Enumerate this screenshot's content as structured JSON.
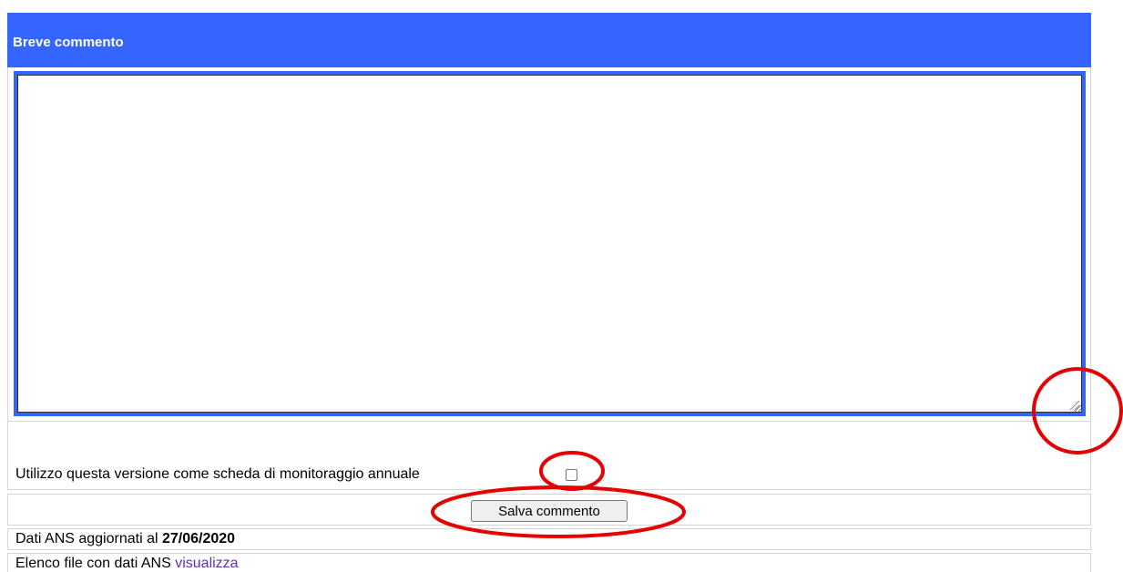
{
  "panel": {
    "title": "Breve commento"
  },
  "comment": {
    "value": "",
    "placeholder": ""
  },
  "annual_monitoring": {
    "label": "Utilizzo questa versione come scheda di monitoraggio annuale",
    "checked": false
  },
  "save": {
    "label": "Salva commento"
  },
  "ans_info": {
    "prefix": "Dati ANS aggiornati al",
    "date": "27/06/2020"
  },
  "ans_files": {
    "prefix": "Elenco file con dati ANS",
    "link_label": "visualizza"
  },
  "colors": {
    "header_bg": "#3465ff",
    "annotation": "#e60000",
    "link": "#5d2fb5"
  },
  "annotations": [
    {
      "target": "textarea-resize-handle",
      "shape": "circle"
    },
    {
      "target": "annual-monitoring-checkbox",
      "shape": "circle"
    },
    {
      "target": "save-comment-button",
      "shape": "ellipse"
    }
  ]
}
